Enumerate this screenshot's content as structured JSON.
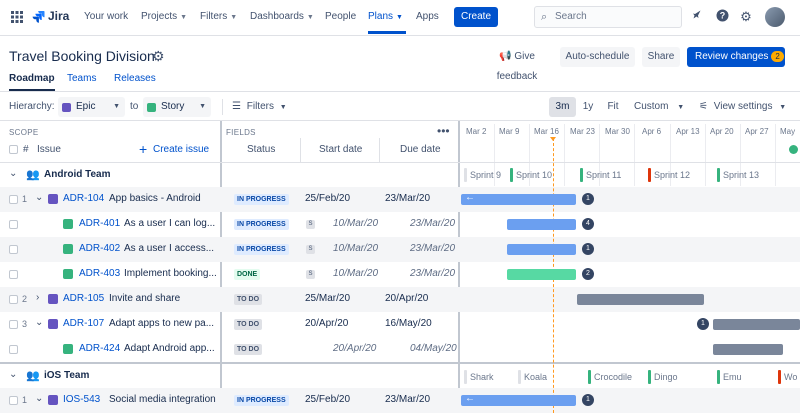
{
  "nav": {
    "logo": "Jira",
    "items": [
      {
        "label": "Your work",
        "chevron": false
      },
      {
        "label": "Projects",
        "chevron": true
      },
      {
        "label": "Filters",
        "chevron": true
      },
      {
        "label": "Dashboards",
        "chevron": true
      },
      {
        "label": "People",
        "chevron": false
      },
      {
        "label": "Plans",
        "chevron": true,
        "active": true
      },
      {
        "label": "Apps",
        "chevron": false
      }
    ],
    "create_label": "Create",
    "search_placeholder": "Search"
  },
  "header": {
    "title": "Travel Booking Division",
    "give_feedback": "Give feedback",
    "auto_schedule": "Auto-schedule",
    "share": "Share",
    "review_changes": "Review changes",
    "review_count": "2"
  },
  "tabs": [
    "Roadmap",
    "Teams",
    "Releases"
  ],
  "toolbar": {
    "hierarchy_label": "Hierarchy:",
    "from": "Epic",
    "to_label": "to",
    "to": "Story",
    "filters": "Filters",
    "zoom": [
      "3m",
      "1y",
      "Fit"
    ],
    "custom": "Custom",
    "view_settings": "View settings"
  },
  "columns": {
    "scope": "SCOPE",
    "fields": "FIELDS",
    "hash": "#",
    "issue": "Issue",
    "create_issue": "Create issue",
    "status": "Status",
    "start_date": "Start date",
    "due_date": "Due date"
  },
  "timeline": {
    "months": [
      "Mar 2",
      "Mar 9",
      "Mar 16",
      "Mar 23",
      "Mar 30",
      "Apr 6",
      "Apr 13",
      "Apr 20",
      "Apr 27",
      "May"
    ],
    "android_sprints": [
      {
        "name": "Sprint 9",
        "color": "#dfe1e6"
      },
      {
        "name": "Sprint 10",
        "color": "#36b37e"
      },
      {
        "name": "Sprint 11",
        "color": "#36b37e"
      },
      {
        "name": "Sprint 12",
        "color": "#de350b"
      },
      {
        "name": "Sprint 13",
        "color": "#36b37e"
      }
    ],
    "ios_sprints": [
      {
        "name": "Shark",
        "color": "#dfe1e6"
      },
      {
        "name": "Koala",
        "color": "#dfe1e6"
      },
      {
        "name": "Crocodile",
        "color": "#36b37e"
      },
      {
        "name": "Dingo",
        "color": "#36b37e"
      },
      {
        "name": "Emu",
        "color": "#36b37e"
      },
      {
        "name": "Wo",
        "color": "#de350b"
      }
    ]
  },
  "teams": {
    "android": "Android Team",
    "ios": "iOS Team"
  },
  "rows": [
    {
      "num": "1",
      "expand": "v",
      "type": "epic",
      "key": "ADR-104",
      "summary": "App basics - Android",
      "status": "IN PROGRESS",
      "start": "25/Feb/20",
      "due": "23/Mar/20",
      "inherited": false,
      "count": "1"
    },
    {
      "num": "",
      "expand": "",
      "type": "story",
      "key": "ADR-401",
      "summary": "As a user I can log...",
      "status": "IN PROGRESS",
      "start": "10/Mar/20",
      "due": "23/Mar/20",
      "inherited": true,
      "count": "4"
    },
    {
      "num": "",
      "expand": "",
      "type": "story",
      "key": "ADR-402",
      "summary": "As a user I access...",
      "status": "IN PROGRESS",
      "start": "10/Mar/20",
      "due": "23/Mar/20",
      "inherited": true,
      "count": "1"
    },
    {
      "num": "",
      "expand": "",
      "type": "story",
      "key": "ADR-403",
      "summary": "Implement booking...",
      "status": "DONE",
      "start": "10/Mar/20",
      "due": "23/Mar/20",
      "inherited": true,
      "count": "2"
    },
    {
      "num": "2",
      "expand": ">",
      "type": "epic",
      "key": "ADR-105",
      "summary": "Invite and share",
      "status": "TO DO",
      "start": "25/Mar/20",
      "due": "20/Apr/20",
      "inherited": false,
      "count": ""
    },
    {
      "num": "3",
      "expand": "v",
      "type": "epic",
      "key": "ADR-107",
      "summary": "Adapt apps to new pa...",
      "status": "TO DO",
      "start": "20/Apr/20",
      "due": "16/May/20",
      "inherited": false,
      "count": "1"
    },
    {
      "num": "",
      "expand": "",
      "type": "story",
      "key": "ADR-424",
      "summary": "Adapt Android app...",
      "status": "TO DO",
      "start": "20/Apr/20",
      "due": "04/May/20",
      "inherited": true,
      "count": ""
    },
    {
      "num": "1",
      "expand": "v",
      "type": "epic",
      "key": "IOS-543",
      "summary": "Social media integration",
      "status": "IN PROGRESS",
      "start": "25/Feb/20",
      "due": "23/Mar/20",
      "inherited": false,
      "count": "1"
    }
  ]
}
